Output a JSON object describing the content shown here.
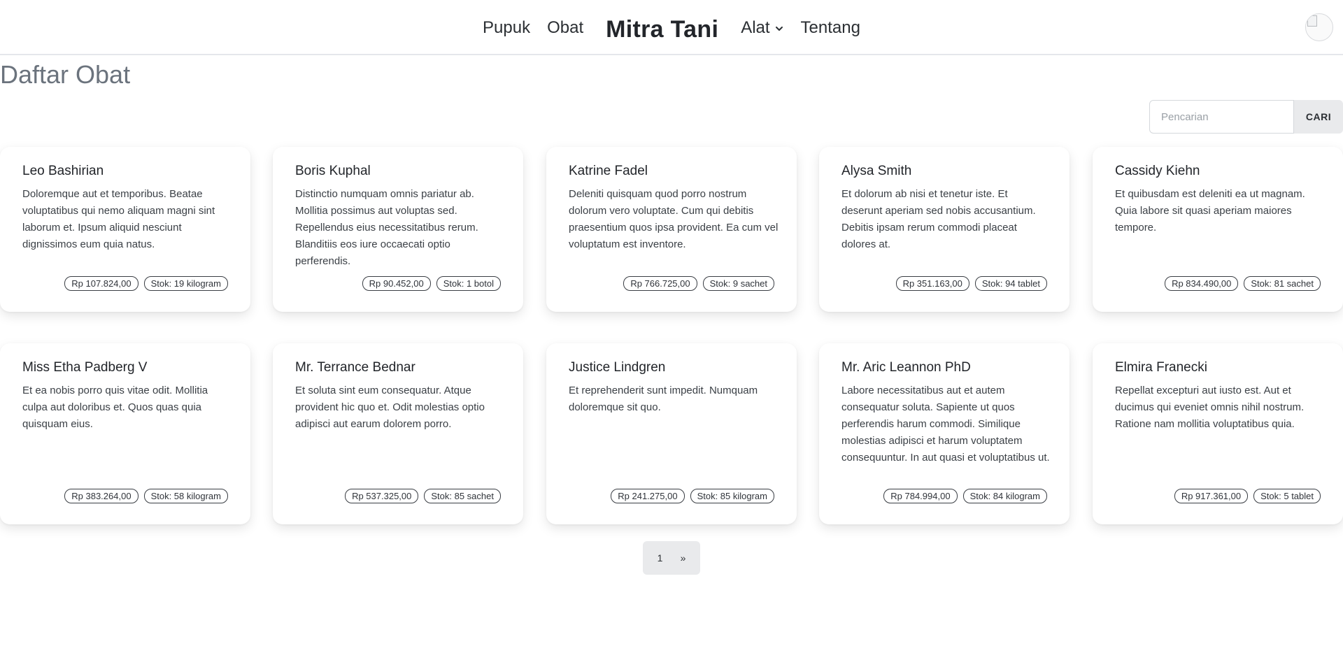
{
  "nav": {
    "left_links": [
      "Pupuk",
      "Obat"
    ],
    "brand": "Mitra Tani",
    "dropdown_label": "Alat",
    "right_link": "Tentang"
  },
  "page": {
    "title": "Daftar Obat"
  },
  "search": {
    "placeholder": "Pencarian",
    "value": "",
    "button_label": "CARI"
  },
  "products": [
    {
      "name": "Leo Bashirian",
      "description": "Doloremque aut et temporibus. Beatae voluptatibus qui nemo aliquam magni sint laborum et. Ipsum aliquid nesciunt dignissimos eum quia natus.",
      "price": "Rp 107.824,00",
      "stock": "Stok: 19 kilogram"
    },
    {
      "name": "Boris Kuphal",
      "description": "Distinctio numquam omnis pariatur ab. Mollitia possimus aut voluptas sed. Repellendus eius necessitatibus rerum. Blanditiis eos iure occaecati optio perferendis.",
      "price": "Rp 90.452,00",
      "stock": "Stok: 1 botol"
    },
    {
      "name": "Katrine Fadel",
      "description": "Deleniti quisquam quod porro nostrum dolorum vero voluptate. Cum qui debitis praesentium quos ipsa provident. Ea cum vel voluptatum est inventore.",
      "price": "Rp 766.725,00",
      "stock": "Stok: 9 sachet"
    },
    {
      "name": "Alysa Smith",
      "description": "Et dolorum ab nisi et tenetur iste. Et deserunt aperiam sed nobis accusantium. Debitis ipsam rerum commodi placeat dolores at.",
      "price": "Rp 351.163,00",
      "stock": "Stok: 94 tablet"
    },
    {
      "name": "Cassidy Kiehn",
      "description": "Et quibusdam est deleniti ea ut magnam. Quia labore sit quasi aperiam maiores tempore.",
      "price": "Rp 834.490,00",
      "stock": "Stok: 81 sachet"
    },
    {
      "name": "Miss Etha Padberg V",
      "description": "Et ea nobis porro quis vitae odit. Mollitia culpa aut doloribus et. Quos quas quia quisquam eius.",
      "price": "Rp 383.264,00",
      "stock": "Stok: 58 kilogram"
    },
    {
      "name": "Mr. Terrance Bednar",
      "description": "Et soluta sint eum consequatur. Atque provident hic quo et. Odit molestias optio adipisci aut earum dolorem porro.",
      "price": "Rp 537.325,00",
      "stock": "Stok: 85 sachet"
    },
    {
      "name": "Justice Lindgren",
      "description": "Et reprehenderit sunt impedit. Numquam doloremque sit quo.",
      "price": "Rp 241.275,00",
      "stock": "Stok: 85 kilogram"
    },
    {
      "name": "Mr. Aric Leannon PhD",
      "description": "Labore necessitatibus aut et autem consequatur soluta. Sapiente ut quos perferendis harum commodi. Similique molestias adipisci et harum voluptatem consequuntur. In aut quasi et voluptatibus ut.",
      "price": "Rp 784.994,00",
      "stock": "Stok: 84 kilogram"
    },
    {
      "name": "Elmira Franecki",
      "description": "Repellat excepturi aut iusto est. Aut et ducimus qui eveniet omnis nihil nostrum. Ratione nam mollitia voluptatibus quia.",
      "price": "Rp 917.361,00",
      "stock": "Stok: 5 tablet"
    }
  ],
  "pagination": {
    "current": "1",
    "next": "»"
  },
  "icons": {
    "dropdown": "chevron-down-icon",
    "avatar": "broken-image-icon"
  }
}
